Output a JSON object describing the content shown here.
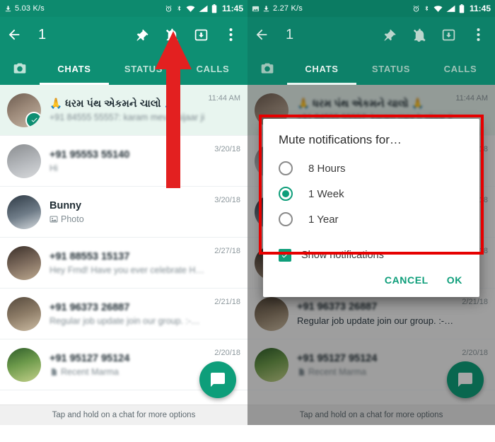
{
  "left": {
    "statusbar": {
      "speed": "5.03 K/s",
      "clock": "11:45",
      "icons": [
        "download-icon",
        "alarm-icon",
        "bluetooth-icon",
        "wifi-icon",
        "signal-icon",
        "battery-icon"
      ]
    },
    "appbar": {
      "back_icon": "back-arrow-icon",
      "selection_count": "1",
      "actions": [
        "pin-icon",
        "mute-icon",
        "archive-icon",
        "overflow-menu-icon"
      ]
    },
    "tabs": [
      {
        "label": "",
        "name": "camera",
        "active": false
      },
      {
        "label": "CHATS",
        "name": "chats",
        "active": true
      },
      {
        "label": "STATUS",
        "name": "status",
        "active": false
      },
      {
        "label": "CALLS",
        "name": "calls",
        "active": false
      }
    ],
    "chats": [
      {
        "title": "🙏 ધરમ પંથ એકમને ચાલો 🙏",
        "message": "+91 84555 55557: karam mev h sijaar ji",
        "time": "11:44 AM",
        "selected": true,
        "blurred": true,
        "avatar": "av1"
      },
      {
        "title": "+91 95553 55140",
        "message": "Hi",
        "time": "3/20/18",
        "selected": false,
        "blurred": true,
        "avatar": "av2"
      },
      {
        "title": "Bunny",
        "message": "Photo",
        "time": "3/20/18",
        "selected": false,
        "blurred": false,
        "avatar": "av3",
        "icon": "photo-icon"
      },
      {
        "title": "+91 88553 15137",
        "message": "Hey Frnd! Have you ever celebrate H…",
        "time": "2/27/18",
        "selected": false,
        "blurred": true,
        "avatar": "av4"
      },
      {
        "title": "+91 96373 26887",
        "message": "Regular job update join our group. :-…",
        "time": "2/21/18",
        "selected": false,
        "blurred": true,
        "avatar": "av5"
      },
      {
        "title": "+91 95127 95124",
        "message": "Recent Marma",
        "time": "2/20/18",
        "selected": false,
        "blurred": true,
        "avatar": "av6",
        "icon": "doc-icon"
      }
    ],
    "fab": "new-chat-fab",
    "hint": "Tap and hold on a chat for more options",
    "annotation": {
      "type": "arrow",
      "color": "#e32020",
      "points_to": "mute-icon"
    }
  },
  "right": {
    "statusbar": {
      "speed": "2.27 K/s",
      "clock": "11:45",
      "icons": [
        "image-icon",
        "download-icon",
        "alarm-icon",
        "bluetooth-icon",
        "wifi-icon",
        "signal-icon",
        "battery-icon"
      ]
    },
    "appbar": {
      "back_icon": "back-arrow-icon",
      "selection_count": "1",
      "actions": [
        "pin-icon",
        "mute-icon",
        "archive-icon",
        "overflow-menu-icon"
      ]
    },
    "tabs": [
      {
        "label": "",
        "name": "camera",
        "active": false
      },
      {
        "label": "CHATS",
        "name": "chats",
        "active": true
      },
      {
        "label": "STATUS",
        "name": "status",
        "active": false
      },
      {
        "label": "CALLS",
        "name": "calls",
        "active": false
      }
    ],
    "chats": [
      {
        "title": "🙏 ધરમ પંથ એકમને ચાલો 🙏",
        "message": "+91 84555 55557: karam mev h sijaar ji",
        "time": "11:44 AM",
        "selected": true,
        "blurred": true,
        "avatar": "av1"
      },
      {
        "title": "+91 95553 55140",
        "message": "Hi",
        "time": "3/20/18",
        "selected": false,
        "blurred": true,
        "avatar": "av2"
      },
      {
        "title": "Bunny",
        "message": "Photo",
        "time": "3/20/18",
        "selected": false,
        "blurred": false,
        "avatar": "av3",
        "icon": "photo-icon"
      },
      {
        "title": "+91 88553 15137",
        "message": "Hey Frnd! Have you ever celebrate H…",
        "time": "2/27/18",
        "selected": false,
        "blurred": true,
        "avatar": "av4"
      },
      {
        "title": "+91 96373 26887",
        "message": "Regular job update join our group. :-…",
        "time": "2/21/18",
        "selected": false,
        "blurred": false,
        "avatar": "av5"
      },
      {
        "title": "+91 95127 95124",
        "message": "Recent Marma",
        "time": "2/20/18",
        "selected": false,
        "blurred": true,
        "avatar": "av6",
        "icon": "doc-icon"
      }
    ],
    "fab": "new-chat-fab",
    "hint": "Tap and hold on a chat for more options",
    "dialog": {
      "title": "Mute notifications for…",
      "options": [
        {
          "label": "8 Hours",
          "selected": false
        },
        {
          "label": "1 Week",
          "selected": true
        },
        {
          "label": "1 Year",
          "selected": false
        }
      ],
      "checkbox": {
        "label": "Show notifications",
        "checked": true
      },
      "cancel_label": "CANCEL",
      "ok_label": "OK",
      "accent_color": "#0e9e7a",
      "highlight_color": "#e60000"
    }
  }
}
